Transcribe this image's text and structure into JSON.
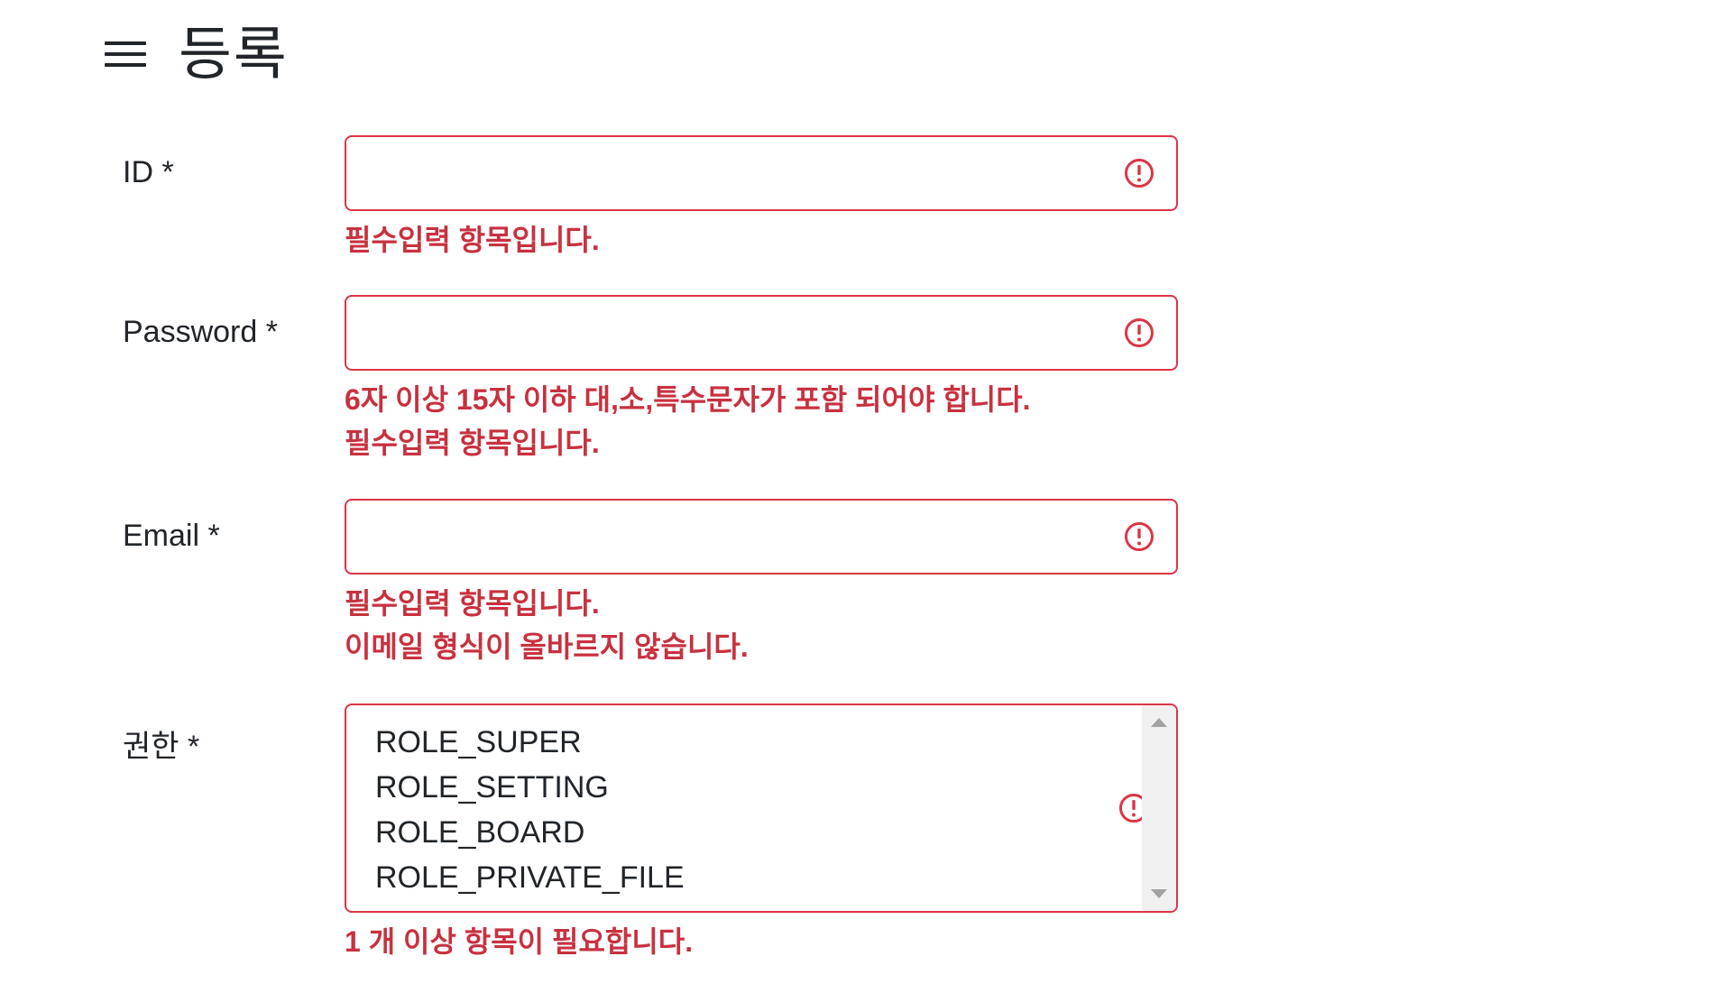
{
  "header": {
    "title": "등록"
  },
  "form": {
    "id": {
      "label": "ID *",
      "value": "",
      "errors": [
        "필수입력 항목입니다."
      ]
    },
    "password": {
      "label": "Password *",
      "value": "",
      "errors": [
        "6자 이상 15자 이하 대,소,특수문자가 포함 되어야 합니다.",
        "필수입력 항목입니다."
      ]
    },
    "email": {
      "label": "Email *",
      "value": "",
      "errors": [
        "필수입력 항목입니다.",
        "이메일 형식이 올바르지 않습니다."
      ]
    },
    "roles": {
      "label": "권한 *",
      "options": [
        "ROLE_SUPER",
        "ROLE_SETTING",
        "ROLE_BOARD",
        "ROLE_PRIVATE_FILE"
      ],
      "errors": [
        "1 개 이상 항목이 필요합니다."
      ]
    }
  },
  "colors": {
    "error": "#dc3545",
    "error_text": "#c8313f",
    "text": "#212529"
  },
  "icons": {
    "menu": "hamburger-menu-icon",
    "invalid": "exclamation-circle-icon"
  }
}
